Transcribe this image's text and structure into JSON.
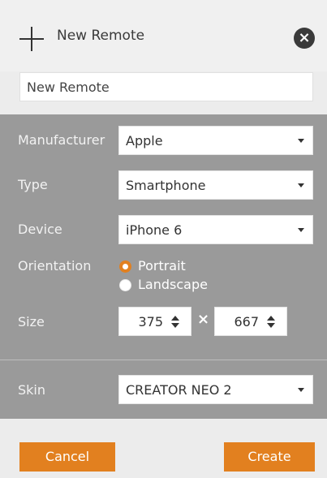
{
  "header": {
    "title": "New Remote"
  },
  "name_input": {
    "value": "New Remote"
  },
  "form": {
    "manufacturer": {
      "label": "Manufacturer",
      "value": "Apple"
    },
    "type": {
      "label": "Type",
      "value": "Smartphone"
    },
    "device": {
      "label": "Device",
      "value": "iPhone 6"
    },
    "orientation": {
      "label": "Orientation",
      "options": [
        "Portrait",
        "Landscape"
      ],
      "selected": "Portrait"
    },
    "size": {
      "label": "Size",
      "width": "375",
      "height": "667",
      "separator": "×"
    },
    "skin": {
      "label": "Skin",
      "value": "CREATOR NEO 2"
    }
  },
  "buttons": {
    "cancel": "Cancel",
    "create": "Create"
  },
  "colors": {
    "accent": "#e2801f",
    "panel": "#9a9a9a",
    "header": "#f0f0f0"
  },
  "icons": {
    "add": "plus-icon",
    "close": "close-icon",
    "dropdown": "caret-down-icon",
    "spinner": "spinner-arrows-icon"
  }
}
